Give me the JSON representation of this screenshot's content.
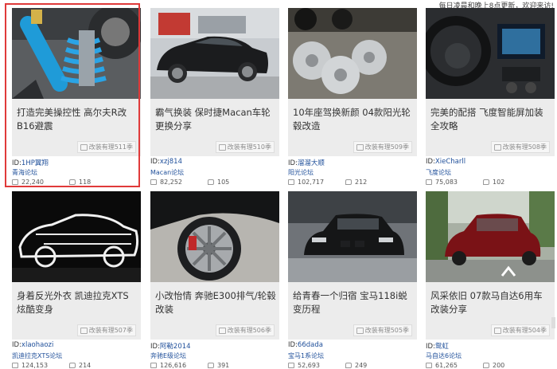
{
  "header": {
    "note": "每日凌晨和晚上8点更新，欢迎来访!"
  },
  "cards": [
    {
      "title": "打造完美操控性 高尔夫R改B16避震",
      "tag": "改装有理511季",
      "author_prefix": "ID:",
      "author": "1HP翼翔",
      "forum": "青海论坛",
      "views": "22,240",
      "comments": "118"
    },
    {
      "title": "霸气换装 保时捷Macan车轮更换分享",
      "tag": "改装有理510季",
      "author_prefix": "ID:",
      "author": "xzj814",
      "forum": "Macan论坛",
      "views": "82,252",
      "comments": "105"
    },
    {
      "title": "10年座驾换新颜 04款阳光轮毂改造",
      "tag": "改装有理509季",
      "author_prefix": "ID:",
      "author": "溜溜大顺",
      "forum": "阳光论坛",
      "views": "102,717",
      "comments": "212"
    },
    {
      "title": "完美的配搭 飞度智能屏加装全攻略",
      "tag": "改装有理508季",
      "author_prefix": "ID:",
      "author": "XieCharll",
      "forum": "飞度论坛",
      "views": "75,083",
      "comments": "102"
    },
    {
      "title": "身着反光外衣 凯迪拉克XTS炫酷变身",
      "tag": "改装有理507季",
      "author_prefix": "ID:",
      "author": "xlaohaozi",
      "forum": "凯迪拉克XTS论坛",
      "views": "124,153",
      "comments": "214"
    },
    {
      "title": "小改怡情 奔驰E300排气/轮毂改装",
      "tag": "改装有理506季",
      "author_prefix": "ID:",
      "author": "阿勒2014",
      "forum": "奔驰E级论坛",
      "views": "126,616",
      "comments": "391"
    },
    {
      "title": "给青春一个归宿 宝马118i蜕变历程",
      "tag": "改装有理505季",
      "author_prefix": "ID:",
      "author": "66dada",
      "forum": "宝马1系论坛",
      "views": "52,693",
      "comments": "249"
    },
    {
      "title": "风采依旧 07款马自达6用车改装分享",
      "tag": "改装有理504季",
      "author_prefix": "ID:",
      "author": "鸳虹",
      "forum": "马自达6论坛",
      "views": "61,265",
      "comments": "200"
    }
  ],
  "icons": {
    "views": "image-icon",
    "comments": "comment-icon"
  },
  "colors": {
    "highlight": "#e03a3a",
    "link": "#1f4f9a",
    "caption_bg": "#ececec"
  }
}
